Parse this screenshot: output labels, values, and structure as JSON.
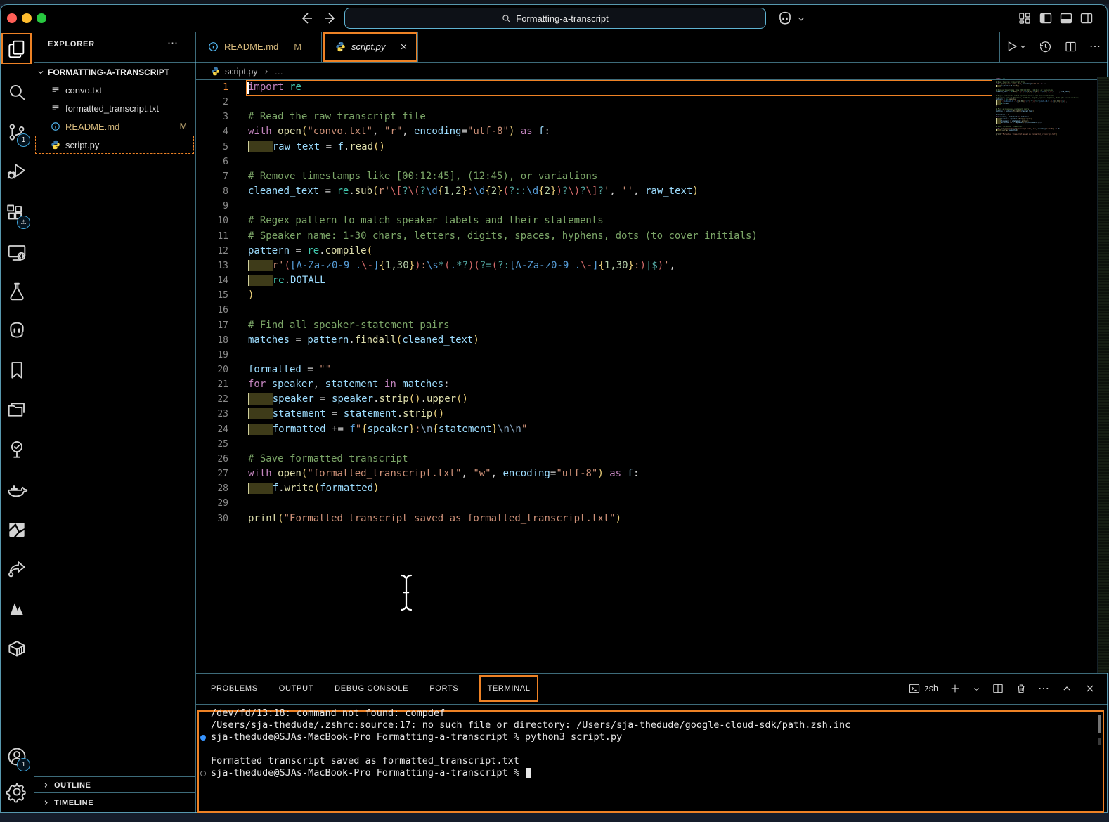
{
  "title_bar": {
    "search_text": "Formatting-a-transcript"
  },
  "activity_bar": {
    "items": [
      {
        "name": "explorer",
        "active": true,
        "focus_box": true
      },
      {
        "name": "search"
      },
      {
        "name": "source-control",
        "badge": "1"
      },
      {
        "name": "run-debug"
      },
      {
        "name": "extensions",
        "badge": "⚠"
      },
      {
        "name": "remote-explorer"
      },
      {
        "name": "testing"
      },
      {
        "name": "chat"
      },
      {
        "name": "bookmarks"
      },
      {
        "name": "project-manager"
      },
      {
        "name": "todo-tree"
      },
      {
        "name": "docker"
      },
      {
        "name": "image-preview"
      },
      {
        "name": "share"
      },
      {
        "name": "mountain"
      },
      {
        "name": "container"
      },
      {
        "name": "accounts",
        "badge": "1",
        "bottom": true
      },
      {
        "name": "settings",
        "bottom": true
      }
    ]
  },
  "sidebar": {
    "header": "EXPLORER",
    "header_more": "⋯",
    "section": "FORMATTING-A-TRANSCRIPT",
    "files": [
      {
        "name": "convo.txt",
        "icon": "textfile"
      },
      {
        "name": "formatted_transcript.txt",
        "icon": "textfile"
      },
      {
        "name": "README.md",
        "icon": "info",
        "badge": "M",
        "modified": true
      },
      {
        "name": "script.py",
        "icon": "python",
        "selected": true
      }
    ],
    "outline_label": "OUTLINE",
    "timeline_label": "TIMELINE"
  },
  "editor": {
    "tabs": [
      {
        "label": "README.md",
        "badge": "M"
      },
      {
        "label": "script.py",
        "active": true
      }
    ],
    "breadcrumb": {
      "file": "script.py",
      "more": "…"
    },
    "active_line": 1,
    "code": [
      {
        "n": 1,
        "t": [
          [
            "import",
            "kw"
          ],
          [
            " ",
            "pun"
          ],
          [
            "re",
            "type"
          ]
        ]
      },
      {
        "n": 2,
        "t": []
      },
      {
        "n": 3,
        "t": [
          [
            "# Read the raw transcript file",
            "com"
          ]
        ]
      },
      {
        "n": 4,
        "t": [
          [
            "with",
            "kw"
          ],
          [
            " ",
            "pun"
          ],
          [
            "open",
            "fn"
          ],
          [
            "(",
            "gold"
          ],
          [
            "\"convo.txt\"",
            "str"
          ],
          [
            ", ",
            "pun"
          ],
          [
            "\"r\"",
            "str"
          ],
          [
            ", ",
            "pun"
          ],
          [
            "encoding",
            "var"
          ],
          [
            "=",
            "pun"
          ],
          [
            "\"utf-8\"",
            "str"
          ],
          [
            ")",
            "gold"
          ],
          [
            " ",
            "pun"
          ],
          [
            "as",
            "kw"
          ],
          [
            " ",
            "pun"
          ],
          [
            "f",
            "var"
          ],
          [
            ":",
            "pun"
          ]
        ]
      },
      {
        "n": 5,
        "t": [
          [
            "    ",
            "ind"
          ],
          [
            "raw_text",
            "var"
          ],
          [
            " = ",
            "pun"
          ],
          [
            "f",
            "var"
          ],
          [
            ".",
            "pun"
          ],
          [
            "read",
            "fn"
          ],
          [
            "()",
            "gold"
          ]
        ]
      },
      {
        "n": 6,
        "t": []
      },
      {
        "n": 7,
        "t": [
          [
            "# Remove timestamps like [00:12:45], (12:45), or variations",
            "com"
          ]
        ]
      },
      {
        "n": 8,
        "t": [
          [
            "cleaned_text",
            "var"
          ],
          [
            " = ",
            "pun"
          ],
          [
            "re",
            "type"
          ],
          [
            ".",
            "pun"
          ],
          [
            "sub",
            "fn"
          ],
          [
            "(",
            "gold"
          ],
          [
            "r'",
            "str"
          ],
          [
            "\\[",
            "rered"
          ],
          [
            "?",
            "reop"
          ],
          [
            "\\(",
            "rered"
          ],
          [
            "?",
            "reop"
          ],
          [
            "\\d",
            "reblue"
          ],
          [
            "{",
            "gold"
          ],
          [
            "1,2",
            "num"
          ],
          [
            "}",
            "gold"
          ],
          [
            ":",
            "str"
          ],
          [
            "\\d",
            "reblue"
          ],
          [
            "{",
            "gold"
          ],
          [
            "2",
            "num"
          ],
          [
            "}",
            "gold"
          ],
          [
            "(",
            "rered"
          ],
          [
            "?::",
            "reop"
          ],
          [
            "\\d",
            "reblue"
          ],
          [
            "{",
            "gold"
          ],
          [
            "2",
            "num"
          ],
          [
            "}",
            "gold"
          ],
          [
            ")",
            "rered"
          ],
          [
            "?",
            "reop"
          ],
          [
            "\\)",
            "rered"
          ],
          [
            "?",
            "reop"
          ],
          [
            "\\]",
            "rered"
          ],
          [
            "?",
            "reop"
          ],
          [
            "'",
            "str"
          ],
          [
            ", ",
            "pun"
          ],
          [
            "''",
            "str"
          ],
          [
            ", ",
            "pun"
          ],
          [
            "raw_text",
            "var"
          ],
          [
            ")",
            "gold"
          ]
        ]
      },
      {
        "n": 9,
        "t": []
      },
      {
        "n": 10,
        "t": [
          [
            "# Regex pattern to match speaker labels and their statements",
            "com"
          ]
        ]
      },
      {
        "n": 11,
        "t": [
          [
            "# Speaker name: 1-30 chars, letters, digits, spaces, hyphens, dots (to cover initials)",
            "com"
          ]
        ]
      },
      {
        "n": 12,
        "t": [
          [
            "pattern",
            "var"
          ],
          [
            " = ",
            "pun"
          ],
          [
            "re",
            "type"
          ],
          [
            ".",
            "pun"
          ],
          [
            "compile",
            "fn"
          ],
          [
            "(",
            "gold"
          ]
        ]
      },
      {
        "n": 13,
        "t": [
          [
            "    ",
            "ind"
          ],
          [
            "r'",
            "str"
          ],
          [
            "(",
            "rered"
          ],
          [
            "[A-Za-z0-9 .",
            "reblue"
          ],
          [
            "\\-",
            "rered"
          ],
          [
            "]",
            "reblue"
          ],
          [
            "{",
            "gold"
          ],
          [
            "1,30",
            "num"
          ],
          [
            "}",
            "gold"
          ],
          [
            ")",
            "rered"
          ],
          [
            ":",
            "str"
          ],
          [
            "\\s",
            "reblue"
          ],
          [
            "*",
            "reop"
          ],
          [
            "(",
            "rered"
          ],
          [
            ".",
            "reblue"
          ],
          [
            "*?",
            "reop"
          ],
          [
            ")",
            "rered"
          ],
          [
            "(",
            "rered"
          ],
          [
            "?=",
            "reop"
          ],
          [
            "(",
            "rered"
          ],
          [
            "?:",
            "reop"
          ],
          [
            "[A-Za-z0-9 .",
            "reblue"
          ],
          [
            "\\-",
            "rered"
          ],
          [
            "]",
            "reblue"
          ],
          [
            "{",
            "gold"
          ],
          [
            "1,30",
            "num"
          ],
          [
            "}",
            "gold"
          ],
          [
            ":",
            "str"
          ],
          [
            ")",
            "rered"
          ],
          [
            "|",
            "reop"
          ],
          [
            "$",
            "reop"
          ],
          [
            ")",
            "rered"
          ],
          [
            "'",
            "str"
          ],
          [
            ",",
            "pun"
          ]
        ]
      },
      {
        "n": 14,
        "t": [
          [
            "    ",
            "ind"
          ],
          [
            "re",
            "type"
          ],
          [
            ".",
            "pun"
          ],
          [
            "DOTALL",
            "var"
          ]
        ]
      },
      {
        "n": 15,
        "t": [
          [
            ")",
            "gold"
          ]
        ]
      },
      {
        "n": 16,
        "t": []
      },
      {
        "n": 17,
        "t": [
          [
            "# Find all speaker-statement pairs",
            "com"
          ]
        ]
      },
      {
        "n": 18,
        "t": [
          [
            "matches",
            "var"
          ],
          [
            " = ",
            "pun"
          ],
          [
            "pattern",
            "var"
          ],
          [
            ".",
            "pun"
          ],
          [
            "findall",
            "fn"
          ],
          [
            "(",
            "gold"
          ],
          [
            "cleaned_text",
            "var"
          ],
          [
            ")",
            "gold"
          ]
        ]
      },
      {
        "n": 19,
        "t": []
      },
      {
        "n": 20,
        "t": [
          [
            "formatted",
            "var"
          ],
          [
            " = ",
            "pun"
          ],
          [
            "\"\"",
            "str"
          ]
        ]
      },
      {
        "n": 21,
        "t": [
          [
            "for",
            "kw"
          ],
          [
            " ",
            "pun"
          ],
          [
            "speaker",
            "var"
          ],
          [
            ", ",
            "pun"
          ],
          [
            "statement",
            "var"
          ],
          [
            " ",
            "pun"
          ],
          [
            "in",
            "kw"
          ],
          [
            " ",
            "pun"
          ],
          [
            "matches",
            "var"
          ],
          [
            ":",
            "pun"
          ]
        ]
      },
      {
        "n": 22,
        "t": [
          [
            "    ",
            "ind"
          ],
          [
            "speaker",
            "var"
          ],
          [
            " = ",
            "pun"
          ],
          [
            "speaker",
            "var"
          ],
          [
            ".",
            "pun"
          ],
          [
            "strip",
            "fn"
          ],
          [
            "()",
            "gold"
          ],
          [
            ".",
            "pun"
          ],
          [
            "upper",
            "fn"
          ],
          [
            "()",
            "gold"
          ]
        ]
      },
      {
        "n": 23,
        "t": [
          [
            "    ",
            "ind"
          ],
          [
            "statement",
            "var"
          ],
          [
            " = ",
            "pun"
          ],
          [
            "statement",
            "var"
          ],
          [
            ".",
            "pun"
          ],
          [
            "strip",
            "fn"
          ],
          [
            "()",
            "gold"
          ]
        ]
      },
      {
        "n": 24,
        "t": [
          [
            "    ",
            "ind"
          ],
          [
            "formatted",
            "var"
          ],
          [
            " ",
            "pun"
          ],
          [
            "+=",
            "pun"
          ],
          [
            " ",
            "pun"
          ],
          [
            "f",
            "reblue"
          ],
          [
            "\"",
            "str"
          ],
          [
            "{",
            "gold"
          ],
          [
            "speaker",
            "var"
          ],
          [
            "}",
            "gold"
          ],
          [
            ":",
            "str"
          ],
          [
            "\\n",
            "esc"
          ],
          [
            "{",
            "gold"
          ],
          [
            "statement",
            "var"
          ],
          [
            "}",
            "gold"
          ],
          [
            "\\n\\n",
            "esc"
          ],
          [
            "\"",
            "str"
          ]
        ]
      },
      {
        "n": 25,
        "t": []
      },
      {
        "n": 26,
        "t": [
          [
            "# Save formatted transcript",
            "com"
          ]
        ]
      },
      {
        "n": 27,
        "t": [
          [
            "with",
            "kw"
          ],
          [
            " ",
            "pun"
          ],
          [
            "open",
            "fn"
          ],
          [
            "(",
            "gold"
          ],
          [
            "\"formatted_transcript.txt\"",
            "str"
          ],
          [
            ", ",
            "pun"
          ],
          [
            "\"w\"",
            "str"
          ],
          [
            ", ",
            "pun"
          ],
          [
            "encoding",
            "var"
          ],
          [
            "=",
            "pun"
          ],
          [
            "\"utf-8\"",
            "str"
          ],
          [
            ")",
            "gold"
          ],
          [
            " ",
            "pun"
          ],
          [
            "as",
            "kw"
          ],
          [
            " ",
            "pun"
          ],
          [
            "f",
            "var"
          ],
          [
            ":",
            "pun"
          ]
        ]
      },
      {
        "n": 28,
        "t": [
          [
            "    ",
            "ind"
          ],
          [
            "f",
            "var"
          ],
          [
            ".",
            "pun"
          ],
          [
            "write",
            "fn"
          ],
          [
            "(",
            "gold"
          ],
          [
            "formatted",
            "var"
          ],
          [
            ")",
            "gold"
          ]
        ]
      },
      {
        "n": 29,
        "t": []
      },
      {
        "n": 30,
        "t": [
          [
            "print",
            "fn"
          ],
          [
            "(",
            "gold"
          ],
          [
            "\"Formatted transcript saved as formatted_transcript.txt\"",
            "str"
          ],
          [
            ")",
            "gold"
          ]
        ]
      }
    ]
  },
  "panel": {
    "tabs": [
      "PROBLEMS",
      "OUTPUT",
      "DEBUG CONSOLE",
      "PORTS",
      "TERMINAL"
    ],
    "active_tab": "TERMINAL",
    "shell": "zsh",
    "terminal": [
      {
        "text": "/dev/fd/13:18: command not found: compdef"
      },
      {
        "text": "/Users/sja-thedude/.zshrc:source:17: no such file or directory: /Users/sja-thedude/google-cloud-sdk/path.zsh.inc"
      },
      {
        "d": "filled",
        "text": "sja-thedude@SJAs-MacBook-Pro Formatting-a-transcript % python3 script.py"
      },
      {
        "text": ""
      },
      {
        "text": "Formatted transcript saved as formatted_transcript.txt"
      },
      {
        "d": "hollow",
        "text": "sja-thedude@SJAs-MacBook-Pro Formatting-a-transcript % ",
        "cursor": true
      }
    ]
  },
  "icon_labels": {
    "more": "⋯"
  },
  "colors": {
    "focus_orange": "#ee8225",
    "contrast_border_cyan": "#6FC3DF",
    "terminal_command_dot": "#3794ff",
    "modified_file": "#d7ba7d",
    "traffic_red": "#ff5f57",
    "traffic_yellow": "#febc2e",
    "traffic_green": "#28c840"
  }
}
